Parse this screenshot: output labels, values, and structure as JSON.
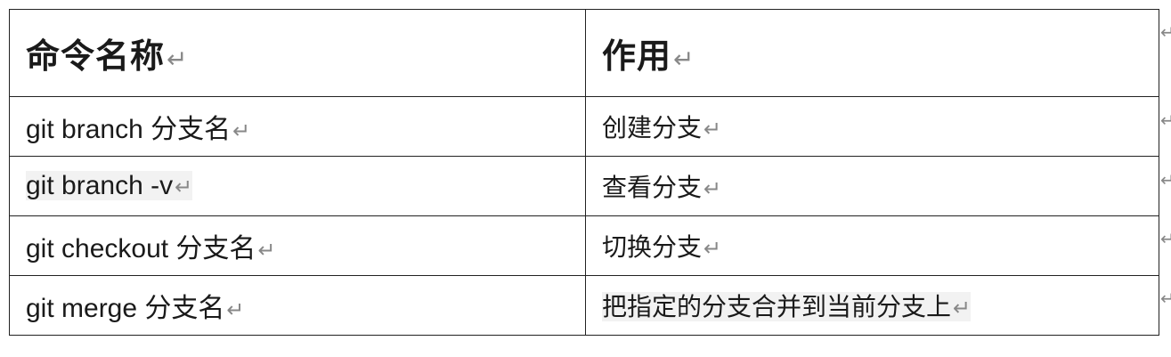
{
  "table": {
    "headers": [
      "命令名称",
      "作用"
    ],
    "rows": [
      {
        "command": "git branch  分支名",
        "effect": "创建分支"
      },
      {
        "command": "git branch -v",
        "effect": "查看分支"
      },
      {
        "command": "git checkout  分支名",
        "effect": "切换分支"
      },
      {
        "command": "git merge  分支名",
        "effect": "把指定的分支合并到当前分支上"
      }
    ]
  },
  "marks": {
    "paragraph": "↵"
  },
  "icons": {
    "paragraph_mark": "return-arrow-icon"
  },
  "colors": {
    "border": "#222222",
    "paragraph_mark": "#888888",
    "highlight": "#f2f2f2"
  }
}
